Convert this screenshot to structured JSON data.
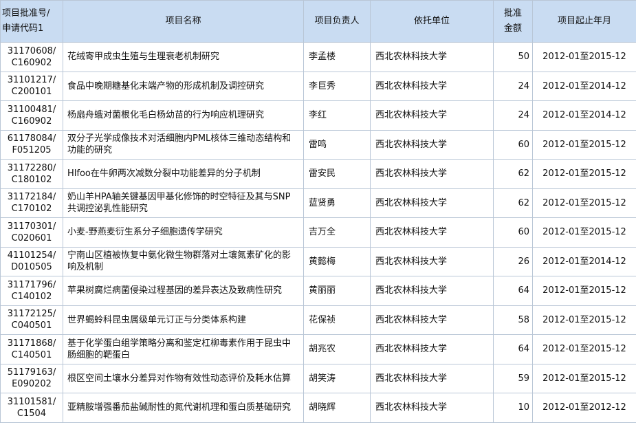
{
  "headers": {
    "code_line1": "项目批准号/",
    "code_line2": "申请代码1",
    "name": "项目名称",
    "leader": "项目负责人",
    "unit": "依托单位",
    "amount_line1": "批准",
    "amount_line2": "金额",
    "period": "项目起止年月"
  },
  "rows": [
    {
      "code1": "31170608/",
      "code2": "C160902",
      "name": "花绒寄甲成虫生殖与生理衰老机制研究",
      "leader": "李孟楼",
      "unit": "西北农林科技大学",
      "amount": "50",
      "period": "2012-01至2015-12"
    },
    {
      "code1": "31101217/",
      "code2": "C200101",
      "name": "食品中晚期糖基化末端产物的形成机制及调控研究",
      "leader": "李巨秀",
      "unit": "西北农林科技大学",
      "amount": "24",
      "period": "2012-01至2014-12"
    },
    {
      "code1": "31100481/",
      "code2": "C160902",
      "name": "杨扇舟蛾对菌根化毛白杨幼苗的行为响应机理研究",
      "leader": "李红",
      "unit": "西北农林科技大学",
      "amount": "24",
      "period": "2012-01至2014-12"
    },
    {
      "code1": "61178084/",
      "code2": "F051205",
      "name": "双分子光学成像技术对活细胞内PML核体三维动态结构和功能的研究",
      "leader": "雷鸣",
      "unit": "西北农林科技大学",
      "amount": "60",
      "period": "2012-01至2015-12"
    },
    {
      "code1": "31172280/",
      "code2": "C180102",
      "name": "Hlfoo在牛卵两次减数分裂中功能差异的分子机制",
      "leader": "雷安民",
      "unit": "西北农林科技大学",
      "amount": "62",
      "period": "2012-01至2015-12"
    },
    {
      "code1": "31172184/",
      "code2": "C170102",
      "name": "奶山羊HPA轴关键基因甲基化修饰的时空特征及其与SNP共调控泌乳性能研究",
      "leader": "蓝贤勇",
      "unit": "西北农林科技大学",
      "amount": "62",
      "period": "2012-01至2015-12"
    },
    {
      "code1": "31170301/",
      "code2": "C020601",
      "name": "小麦-野燕麦衍生系分子细胞遗传学研究",
      "leader": "吉万全",
      "unit": "西北农林科技大学",
      "amount": "60",
      "period": "2012-01至2015-12"
    },
    {
      "code1": "41101254/",
      "code2": "D010505",
      "name": "宁南山区植被恢复中氨化微生物群落对土壤氮素矿化的影响及机制",
      "leader": "黄懿梅",
      "unit": "西北农林科技大学",
      "amount": "26",
      "period": "2012-01至2014-12"
    },
    {
      "code1": "31171796/",
      "code2": "C140102",
      "name": "苹果树腐烂病菌侵染过程基因的差异表达及致病性研究",
      "leader": "黄丽丽",
      "unit": "西北农林科技大学",
      "amount": "64",
      "period": "2012-01至2015-12"
    },
    {
      "code1": "31172125/",
      "code2": "C040501",
      "name": "世界蝎蛉科昆虫属级单元订正与分类体系构建",
      "leader": "花保祯",
      "unit": "西北农林科技大学",
      "amount": "58",
      "period": "2012-01至2015-12"
    },
    {
      "code1": "31171868/",
      "code2": "C140501",
      "name": "基于化学蛋白组学策略分离和鉴定杠柳毒素作用于昆虫中肠细胞的靶蛋白",
      "leader": "胡兆农",
      "unit": "西北农林科技大学",
      "amount": "64",
      "period": "2012-01至2015-12"
    },
    {
      "code1": "51179163/",
      "code2": "E090202",
      "name": "根区空间土壤水分差异对作物有效性动态评价及耗水估算",
      "leader": "胡笑涛",
      "unit": "西北农林科技大学",
      "amount": "59",
      "period": "2012-01至2015-12"
    },
    {
      "code1": "31101581/",
      "code2": "C1504",
      "name": "亚精胺增强番茄盐碱耐性的氮代谢机理和蛋白质基础研究",
      "leader": "胡晓辉",
      "unit": "西北农林科技大学",
      "amount": "10",
      "period": "2012-01至2012-12"
    }
  ]
}
